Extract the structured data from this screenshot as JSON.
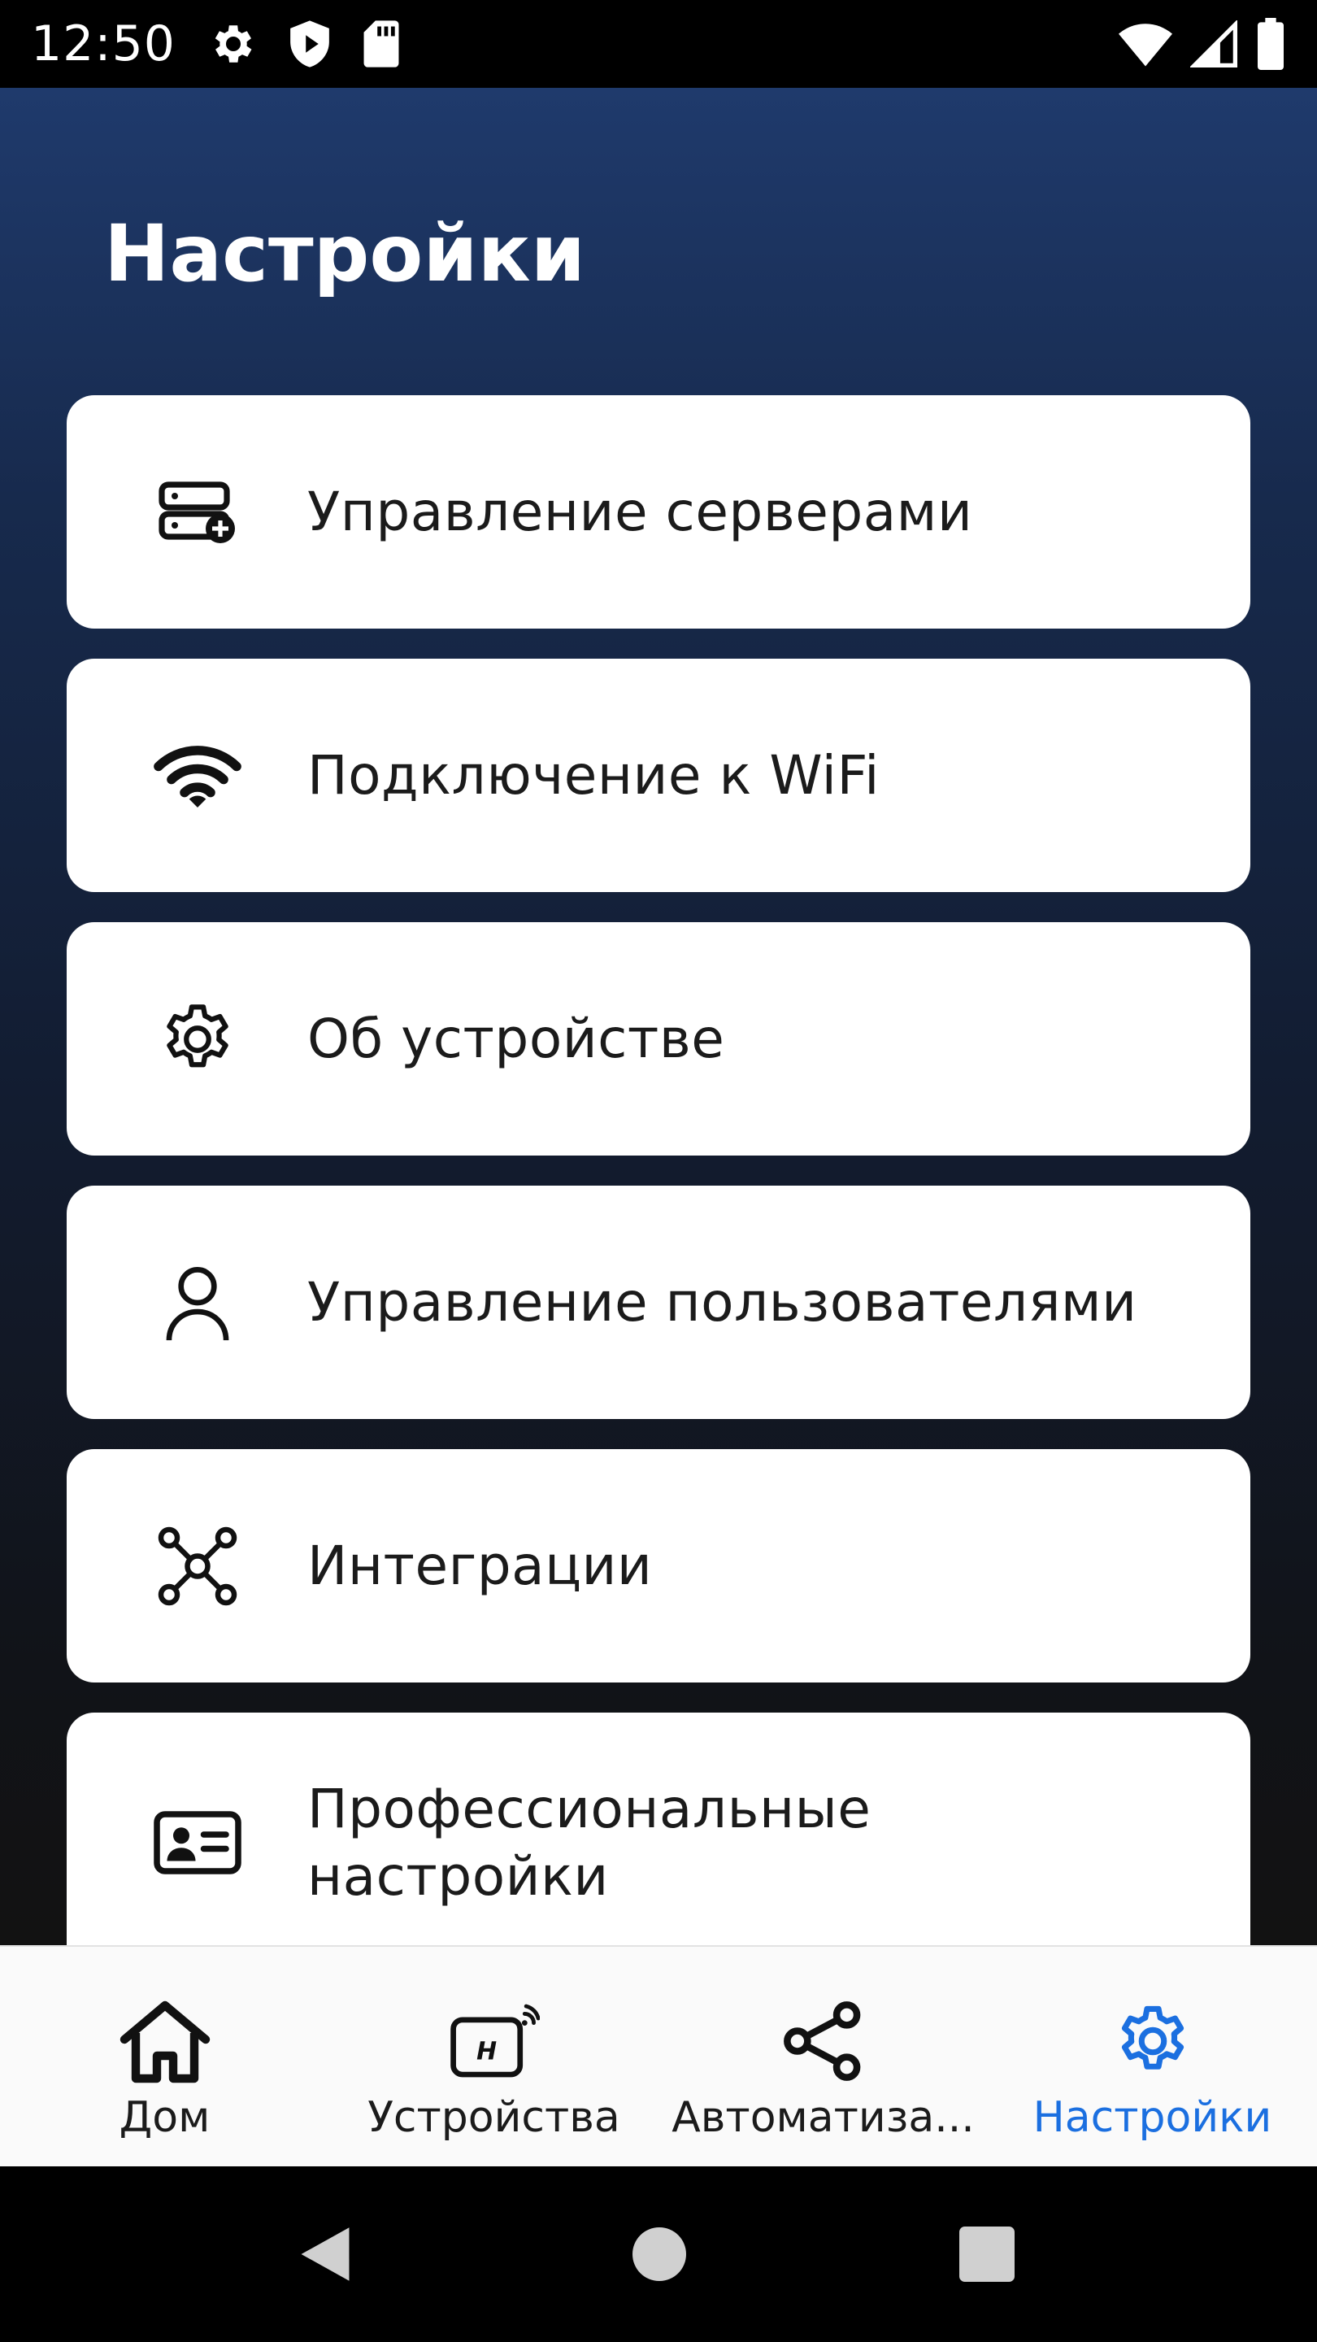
{
  "status_bar": {
    "time": "12:50",
    "icons_left": [
      "gear-icon",
      "shield-icon",
      "sd-card-icon"
    ],
    "icons_right": [
      "wifi-icon",
      "cellular-signal-icon",
      "battery-icon"
    ]
  },
  "page": {
    "title": "Настройки"
  },
  "menu": {
    "items": [
      {
        "label": "Управление серверами",
        "icon": "server-add-icon"
      },
      {
        "label": "Подключение к WiFi",
        "icon": "wifi-icon"
      },
      {
        "label": "Об устройстве",
        "icon": "gear-icon"
      },
      {
        "label": "Управление пользователями",
        "icon": "user-icon"
      },
      {
        "label": "Интеграции",
        "icon": "hub-network-icon"
      },
      {
        "label": "Профессиональные настройки",
        "icon": "id-card-icon"
      }
    ]
  },
  "bottom_nav": {
    "active_color": "#1b6fe0",
    "items": [
      {
        "label": "Дом",
        "icon": "home-icon",
        "active": false
      },
      {
        "label": "Устройства",
        "icon": "hub-device-icon",
        "active": false
      },
      {
        "label": "Автоматиза...",
        "icon": "share-nodes-icon",
        "active": false
      },
      {
        "label": "Настройки",
        "icon": "gear-icon",
        "active": true
      }
    ]
  },
  "system_nav": {
    "buttons": [
      "back-icon",
      "home-circle-icon",
      "recents-square-icon"
    ]
  }
}
